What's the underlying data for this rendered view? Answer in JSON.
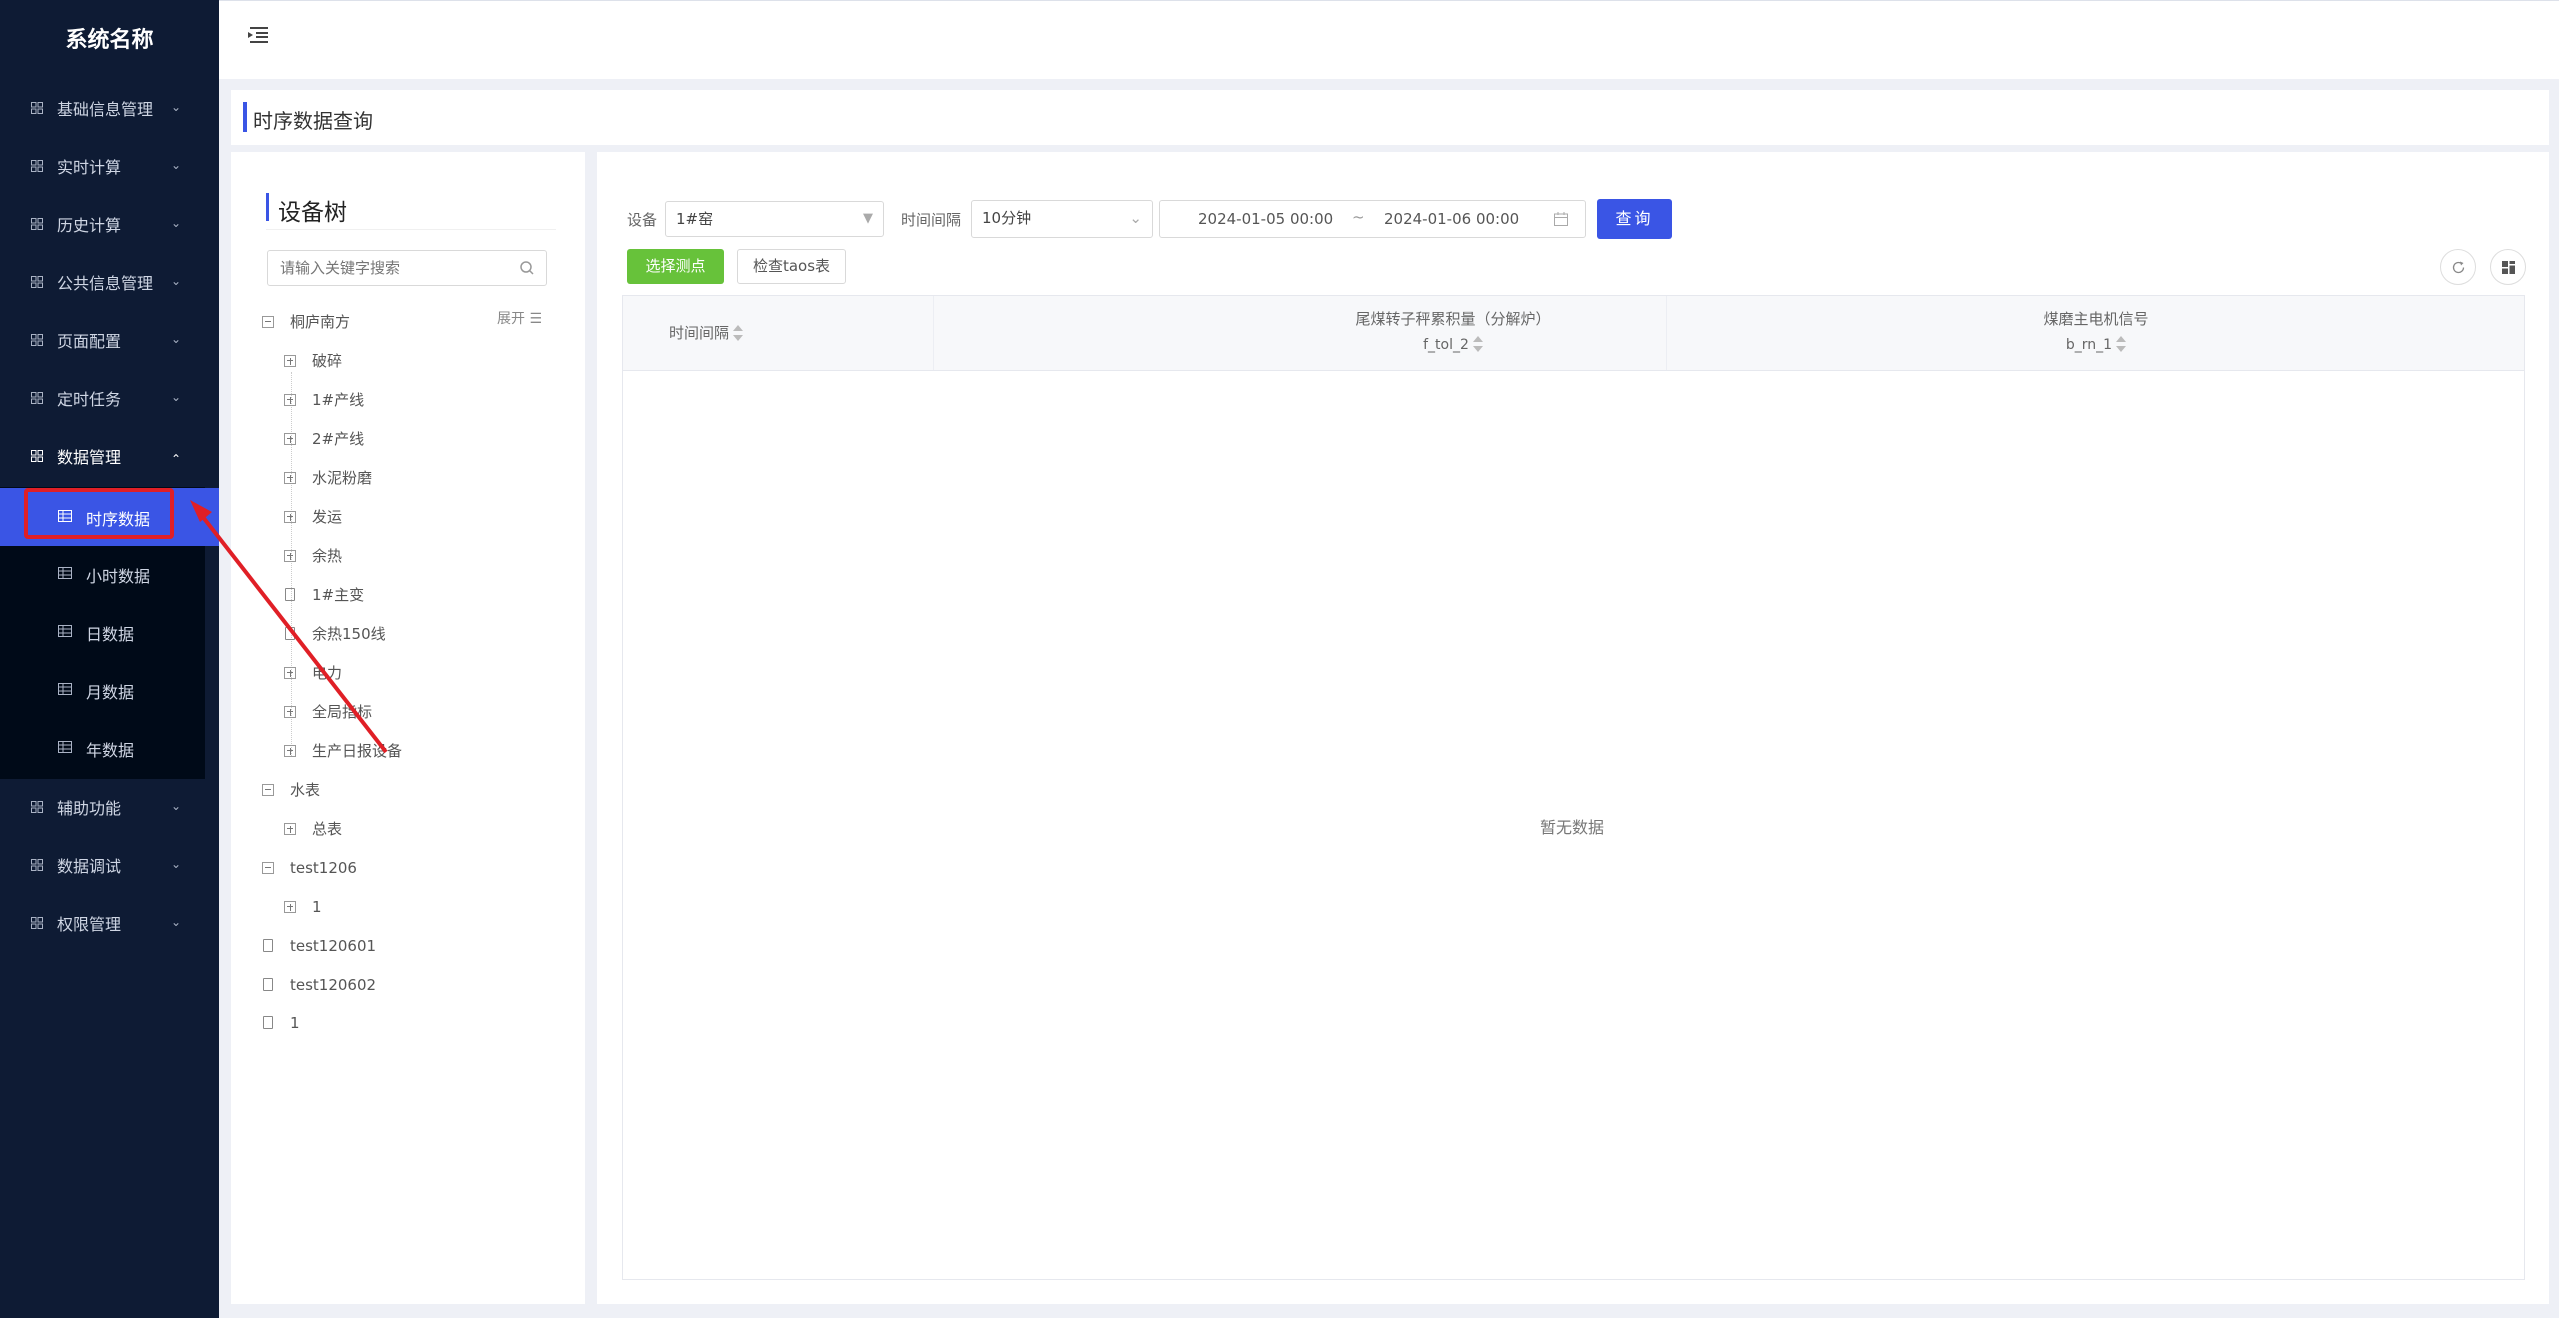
{
  "sidebar": {
    "title": "系统名称",
    "menus": [
      {
        "label": "基础信息管理"
      },
      {
        "label": "实时计算"
      },
      {
        "label": "历史计算"
      },
      {
        "label": "公共信息管理"
      },
      {
        "label": "页面配置"
      },
      {
        "label": "定时任务"
      },
      {
        "label": "数据管理"
      },
      {
        "label": "辅助功能"
      },
      {
        "label": "数据调试"
      },
      {
        "label": "权限管理"
      }
    ],
    "submenu": [
      {
        "label": "时序数据"
      },
      {
        "label": "小时数据"
      },
      {
        "label": "日数据"
      },
      {
        "label": "月数据"
      },
      {
        "label": "年数据"
      }
    ]
  },
  "page": {
    "title": "时序数据查询"
  },
  "tree": {
    "title": "设备树",
    "search_placeholder": "请输入关键字搜索",
    "expand_label": "展开",
    "nodes": [
      {
        "label": "桐庐南方"
      },
      {
        "label": "破碎"
      },
      {
        "label": "1#产线"
      },
      {
        "label": "2#产线"
      },
      {
        "label": "水泥粉磨"
      },
      {
        "label": "发运"
      },
      {
        "label": "余热"
      },
      {
        "label": "1#主变"
      },
      {
        "label": "余热150线"
      },
      {
        "label": "电力"
      },
      {
        "label": "全局指标"
      },
      {
        "label": "生产日报设备"
      },
      {
        "label": "水表"
      },
      {
        "label": "总表"
      },
      {
        "label": "test1206"
      },
      {
        "label": "1"
      },
      {
        "label": "test120601"
      },
      {
        "label": "test120602"
      },
      {
        "label": "1"
      }
    ]
  },
  "filters": {
    "device_label": "设备",
    "device_value": "1#窑",
    "interval_label": "时间间隔",
    "interval_value": "10分钟",
    "start_date": "2024-01-05  00:00",
    "range_sep": "~",
    "end_date": "2024-01-06  00:00",
    "query_button": "查询"
  },
  "actions": {
    "select_points": "选择测点",
    "check_taos": "检查taos表"
  },
  "table": {
    "columns": [
      {
        "title": "时间间隔",
        "sub": ""
      },
      {
        "title": "尾煤转子秤累积量（分解炉）",
        "sub": "f_tol_2"
      },
      {
        "title": "煤磨主电机信号",
        "sub": "b_rn_1"
      }
    ],
    "empty_text": "暂无数据"
  },
  "colors": {
    "sidebar_bg": "#0e1b34",
    "accent": "#3a55e5",
    "success": "#67c23a",
    "highlight_red": "#e01f26"
  }
}
